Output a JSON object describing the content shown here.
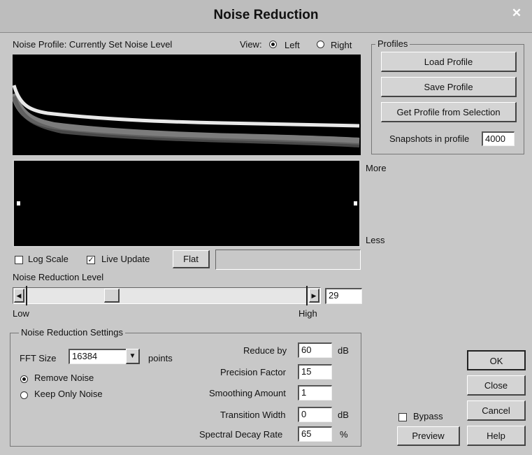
{
  "window": {
    "title": "Noise Reduction"
  },
  "profile_view": {
    "label": "Noise Profile: Currently Set Noise Level",
    "view_label": "View:",
    "left": "Left",
    "right": "Right",
    "selected": "Left"
  },
  "profiles": {
    "title": "Profiles",
    "load": "Load Profile",
    "save": "Save Profile",
    "get": "Get Profile from Selection",
    "snapshots_label": "Snapshots in profile",
    "snapshots_value": "4000"
  },
  "graph": {
    "more": "More",
    "less": "Less"
  },
  "options": {
    "log_scale": "Log Scale",
    "log_scale_checked": false,
    "live_update": "Live Update",
    "live_update_checked": true,
    "flat": "Flat"
  },
  "nr_level": {
    "label": "Noise Reduction Level",
    "low": "Low",
    "high": "High",
    "value": "29"
  },
  "settings": {
    "title": "Noise Reduction Settings",
    "fft_label": "FFT Size",
    "fft_value": "16384",
    "points": "points",
    "remove_noise": "Remove Noise",
    "keep_only_noise": "Keep Only Noise",
    "mode_selected": "Remove Noise",
    "reduce_by_label": "Reduce by",
    "reduce_by_value": "60",
    "reduce_by_unit": "dB",
    "precision_label": "Precision Factor",
    "precision_value": "15",
    "smoothing_label": "Smoothing Amount",
    "smoothing_value": "1",
    "transition_label": "Transition Width",
    "transition_value": "0",
    "transition_unit": "dB",
    "decay_label": "Spectral Decay Rate",
    "decay_value": "65",
    "decay_unit": "%"
  },
  "footer": {
    "bypass": "Bypass",
    "bypass_checked": false,
    "preview": "Preview",
    "ok": "OK",
    "close": "Close",
    "cancel": "Cancel",
    "help": "Help"
  }
}
